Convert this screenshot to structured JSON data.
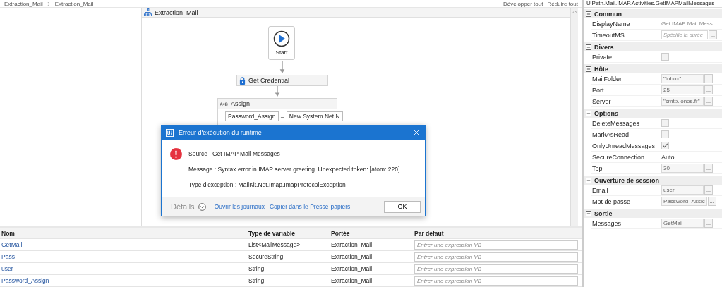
{
  "breadcrumb": [
    {
      "label": "Extraction_Mail"
    },
    {
      "label": "Extraction_Mail"
    }
  ],
  "designer_actions": [
    "Développer tout",
    "Réduire tout"
  ],
  "workflow": {
    "title": "Extraction_Mail",
    "start": {
      "label": "Start"
    },
    "activities": [
      {
        "kind": "credential",
        "title": "Get Credential"
      },
      {
        "kind": "assign",
        "title": "Assign",
        "target": "Password_Assign",
        "operator": "=",
        "value": "New System.Net.N"
      }
    ]
  },
  "variables": {
    "columns": [
      "Nom",
      "Type de variable",
      "Portée",
      "Par défaut"
    ],
    "rows": [
      {
        "name": "GetMail",
        "type": "List<MailMessage>",
        "scope": "Extraction_Mail",
        "default_placeholder": "Entrer une expression VB"
      },
      {
        "name": "Pass",
        "type": "SecureString",
        "scope": "Extraction_Mail",
        "default_placeholder": "Entrer une expression VB"
      },
      {
        "name": "user",
        "type": "String",
        "scope": "Extraction_Mail",
        "default_placeholder": "Entrer une expression VB"
      },
      {
        "name": "Password_Assign",
        "type": "String",
        "scope": "Extraction_Mail",
        "default_placeholder": "Entrer une expression VB"
      }
    ]
  },
  "dialog": {
    "title": "Erreur d'exécution du runtime",
    "lines": [
      "Source : Get IMAP Mail Messages",
      "Message : Syntax error in IMAP server greeting. Unexpected token: [atom: 220]",
      "Type d'exception : MailKit.Net.Imap.ImapProtocolException"
    ],
    "details": "Détails",
    "links": [
      "Ouvrir les journaux",
      "Copier dans le Presse-papiers"
    ],
    "ok": "OK"
  },
  "properties": {
    "title": "UiPath.Mail.IMAP.Activities.GetIMAPMailMessages",
    "categories": [
      {
        "name": "Commun",
        "expanded": true,
        "rows": [
          {
            "label": "DisplayName",
            "kind": "readonly",
            "value": "Get IMAP Mail Mess"
          },
          {
            "label": "TimeoutMS",
            "kind": "field",
            "placeholder": "Spécifie la durée",
            "button": "..."
          }
        ]
      },
      {
        "name": "Divers",
        "expanded": true,
        "rows": [
          {
            "label": "Private",
            "kind": "checkbox",
            "checked": false
          }
        ]
      },
      {
        "name": "Hôte",
        "expanded": true,
        "rows": [
          {
            "label": "MailFolder",
            "kind": "field",
            "value": "\"Inbox\"",
            "button": "..."
          },
          {
            "label": "Port",
            "kind": "field",
            "value": "25",
            "button": "..."
          },
          {
            "label": "Server",
            "kind": "field",
            "value": "\"smtp.ionos.fr\"",
            "button": "..."
          }
        ]
      },
      {
        "name": "Options",
        "expanded": true,
        "rows": [
          {
            "label": "DeleteMessages",
            "kind": "checkbox",
            "checked": false
          },
          {
            "label": "MarkAsRead",
            "kind": "checkbox",
            "checked": false
          },
          {
            "label": "OnlyUnreadMessages",
            "kind": "checkbox",
            "checked": true
          },
          {
            "label": "SecureConnection",
            "kind": "text",
            "value": "Auto"
          },
          {
            "label": "Top",
            "kind": "field",
            "value": "30",
            "button": "..."
          }
        ]
      },
      {
        "name": "Ouverture de session",
        "expanded": true,
        "rows": [
          {
            "label": "Email",
            "kind": "field",
            "value": "user",
            "button": "..."
          },
          {
            "label": "Mot de passe",
            "kind": "field",
            "value": "Password_Assic",
            "button": "..."
          }
        ]
      },
      {
        "name": "Sortie",
        "expanded": true,
        "rows": [
          {
            "label": "Messages",
            "kind": "field",
            "value": "GetMail",
            "button": "..."
          }
        ]
      }
    ]
  }
}
